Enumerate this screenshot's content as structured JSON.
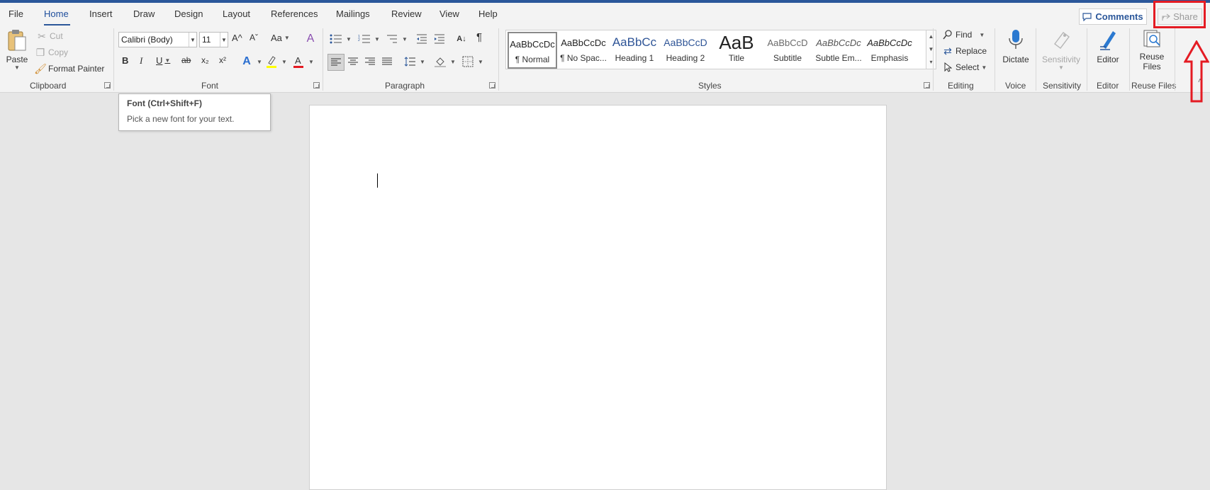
{
  "tabs": {
    "file": "File",
    "home": "Home",
    "insert": "Insert",
    "draw": "Draw",
    "design": "Design",
    "layout": "Layout",
    "references": "References",
    "mailings": "Mailings",
    "review": "Review",
    "view": "View",
    "help": "Help"
  },
  "header": {
    "comments_label": "Comments",
    "share_label": "Share"
  },
  "clipboard": {
    "paste": "Paste",
    "cut": "Cut",
    "copy": "Copy",
    "format_painter": "Format Painter",
    "group_label": "Clipboard"
  },
  "font": {
    "font_name": "Calibri (Body)",
    "font_size": "11",
    "group_label": "Font",
    "bold": "B",
    "italic": "I",
    "underline": "U",
    "strike": "ab",
    "subscript": "x₂",
    "superscript": "x²",
    "change_case": "Aa",
    "grow": "A^",
    "shrink": "Aˇ"
  },
  "paragraph": {
    "group_label": "Paragraph",
    "pilcrow": "¶"
  },
  "styles": {
    "group_label": "Styles",
    "items": [
      {
        "sample": "AaBbCcDc",
        "name": "¶ Normal"
      },
      {
        "sample": "AaBbCcDc",
        "name": "¶ No Spac..."
      },
      {
        "sample": "AaBbCc",
        "name": "Heading 1"
      },
      {
        "sample": "AaBbCcD",
        "name": "Heading 2"
      },
      {
        "sample": "AaB",
        "name": "Title"
      },
      {
        "sample": "AaBbCcD",
        "name": "Subtitle"
      },
      {
        "sample": "AaBbCcDc",
        "name": "Subtle Em..."
      },
      {
        "sample": "AaBbCcDc",
        "name": "Emphasis"
      }
    ]
  },
  "editing": {
    "find": "Find",
    "replace": "Replace",
    "select": "Select",
    "group_label": "Editing"
  },
  "voice": {
    "dictate": "Dictate",
    "group_label": "Voice"
  },
  "sensitivity": {
    "button": "Sensitivity",
    "group_label": "Sensitivity"
  },
  "editor": {
    "button": "Editor",
    "group_label": "Editor"
  },
  "reuse": {
    "button_line1": "Reuse",
    "button_line2": "Files",
    "group_label": "Reuse Files"
  },
  "tooltip": {
    "title": "Font (Ctrl+Shift+F)",
    "text": "Pick a new font for your text."
  },
  "colors": {
    "accent": "#2b579a",
    "highlight": "#e41b23"
  }
}
